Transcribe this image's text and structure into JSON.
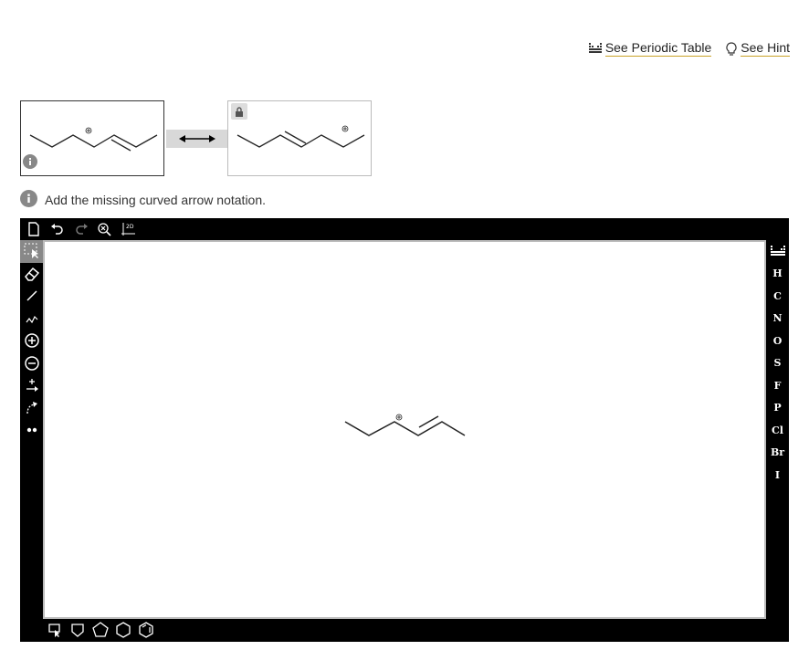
{
  "header": {
    "periodic_table_label": "See Periodic Table",
    "hint_label": "See Hint"
  },
  "instruction": {
    "text": "Add the missing curved arrow notation."
  },
  "editor": {
    "top_tools": [
      "new-document-icon",
      "undo-icon",
      "redo-icon",
      "zoom-clear-icon",
      "clean-2d-icon"
    ],
    "clean_label": "2D",
    "left_tools": [
      "select-icon",
      "eraser-icon",
      "single-bond-icon",
      "chain-icon",
      "positive-charge-icon",
      "negative-charge-icon",
      "reaction-arrow-icon",
      "curved-arrow-icon",
      "lone-pair-icon"
    ],
    "atoms": [
      "H",
      "C",
      "N",
      "O",
      "S",
      "F",
      "P",
      "Cl",
      "Br",
      "I"
    ],
    "bottom_tools": [
      "template-icon",
      "cyclobutane-icon",
      "cyclopentane-icon",
      "cyclohexane-icon",
      "benzene-icon"
    ]
  },
  "colors": {
    "link_underline": "#c9a227",
    "editor_frame": "#000000"
  }
}
